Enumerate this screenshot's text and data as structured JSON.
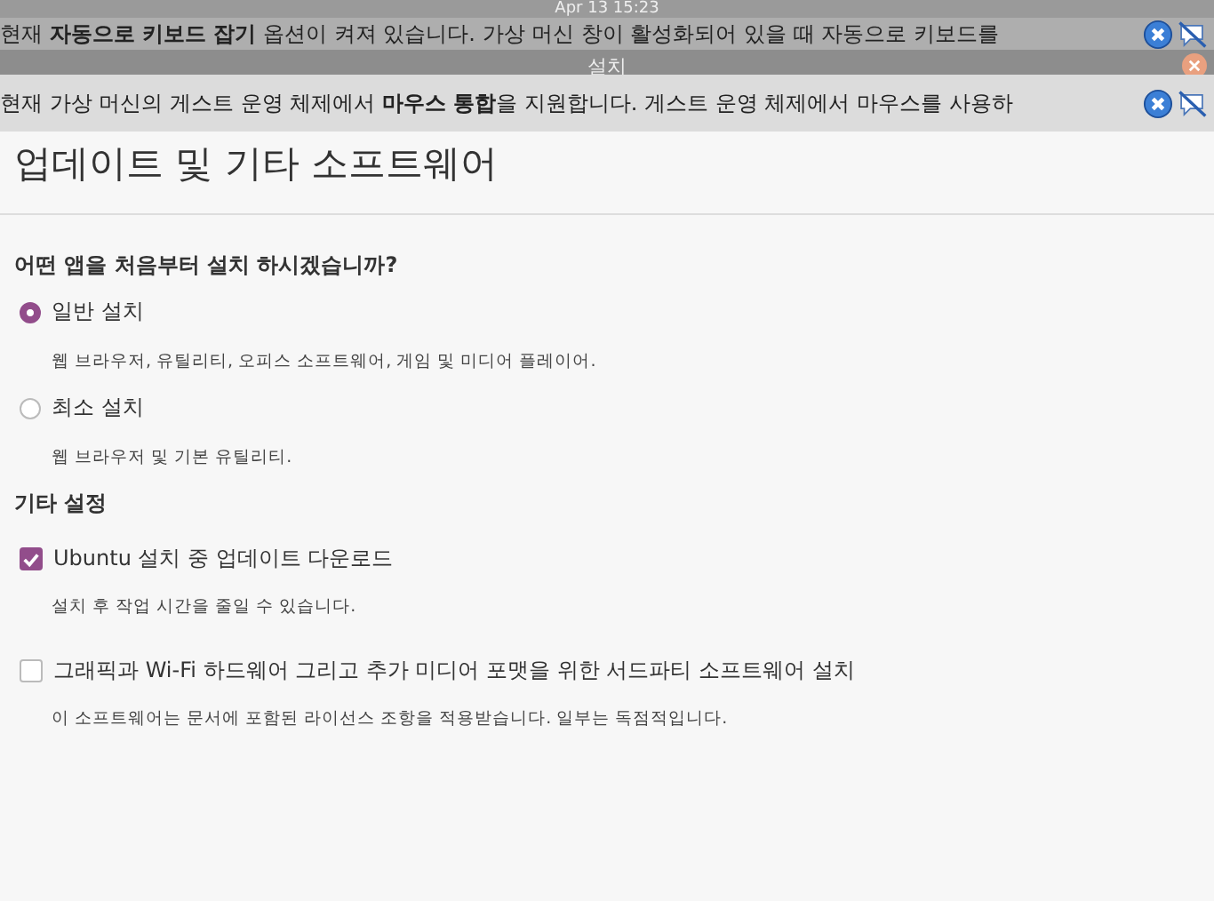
{
  "top_bar": {
    "clock": "Apr 13  15:23"
  },
  "notifications": [
    {
      "text": "현재 **자동으로 키보드 잡기** 옵션이 켜져 있습니다. 가상 머신 창이 활성화되어 있을 때 자동으로 키보드를"
    },
    {
      "text": "현재 가상 머신의 게스트 운영 체제에서 **마우스 통합**을 지원합니다. 게스트 운영 체제에서 마우스를 사용하"
    }
  ],
  "window": {
    "title": "설치"
  },
  "page": {
    "heading": "업데이트 및 기타 소프트웨어",
    "question": "어떤 앱을 처음부터 설치 하시겠습니까?",
    "install_options": [
      {
        "label": "일반 설치",
        "description": "웹 브라우저, 유틸리티, 오피스  소프트웨어, 게임 및 미디어 플레이어.",
        "selected": true
      },
      {
        "label": "최소 설치",
        "description": "웹 브라우저 및 기본 유틸리티.",
        "selected": false
      }
    ],
    "other_heading": "기타 설정",
    "other_options": [
      {
        "label": "Ubuntu 설치 중 업데이트 다운로드",
        "description": "설치 후 작업 시간을 줄일 수 있습니다.",
        "checked": true
      },
      {
        "label": "그래픽과 Wi-Fi 하드웨어 그리고 추가 미디어 포맷을 위한 서드파티 소프트웨어 설치",
        "description": "이 소프트웨어는 문서에 포함된 라이선스 조항을 적용받습니다. 일부는 독점적입니다.",
        "checked": false
      }
    ]
  }
}
